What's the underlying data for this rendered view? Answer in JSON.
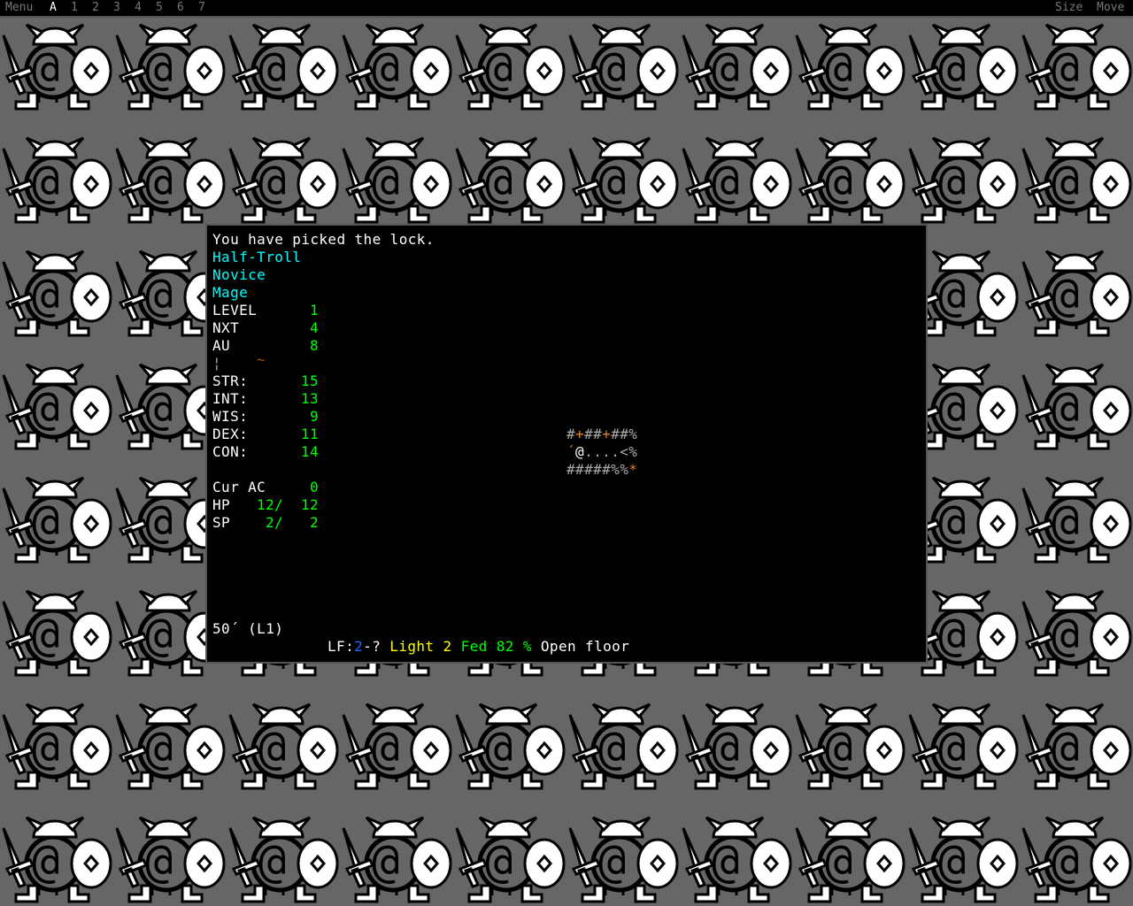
{
  "topbar": {
    "menu": "Menu",
    "tabs": [
      "A",
      "1",
      "2",
      "3",
      "4",
      "5",
      "6",
      "7"
    ],
    "size": "Size",
    "move": "Move"
  },
  "message": "You have picked the lock.",
  "character": {
    "race": "Half-Troll",
    "title": "Novice",
    "class": "Mage"
  },
  "stats": [
    {
      "label": "LEVEL",
      "value": "1"
    },
    {
      "label": "NXT",
      "value": "4"
    },
    {
      "label": "AU",
      "value": "8"
    }
  ],
  "equip_row": {
    "a": "¦",
    "b": "~"
  },
  "attributes": [
    {
      "label": "STR:",
      "value": "15"
    },
    {
      "label": "INT:",
      "value": "13"
    },
    {
      "label": "WIS:",
      "value": "9"
    },
    {
      "label": "DEX:",
      "value": "11"
    },
    {
      "label": "CON:",
      "value": "14"
    }
  ],
  "ac": {
    "label": "Cur AC",
    "value": "0"
  },
  "hp": {
    "label": "HP",
    "cur": "12",
    "max": "12"
  },
  "sp": {
    "label": "SP",
    "cur": "2",
    "max": "2"
  },
  "depth": "50´ (L1)",
  "status": {
    "lf_label": "LF:",
    "lf_value": "2",
    "lf_rest": "-?",
    "light": "Light 2",
    "fed": "Fed 82 %",
    "terrain": "Open floor"
  },
  "map": [
    [
      {
        "t": "#",
        "c": "gr"
      },
      {
        "t": "+",
        "c": "o"
      },
      {
        "t": "##",
        "c": "gr"
      },
      {
        "t": "+",
        "c": "o"
      },
      {
        "t": "##%",
        "c": "gr"
      }
    ],
    [
      {
        "t": "´",
        "c": "o"
      },
      {
        "t": "@",
        "c": "w"
      },
      {
        "t": "....<%",
        "c": "gr"
      }
    ],
    [
      {
        "t": "#####%%",
        "c": "gr"
      },
      {
        "t": "*",
        "c": "o"
      }
    ]
  ],
  "colors": {
    "cyan": "#00ffff",
    "green": "#00ff00",
    "yellow": "#ffff00",
    "blue": "#2266ff",
    "orange": "#e08020"
  }
}
